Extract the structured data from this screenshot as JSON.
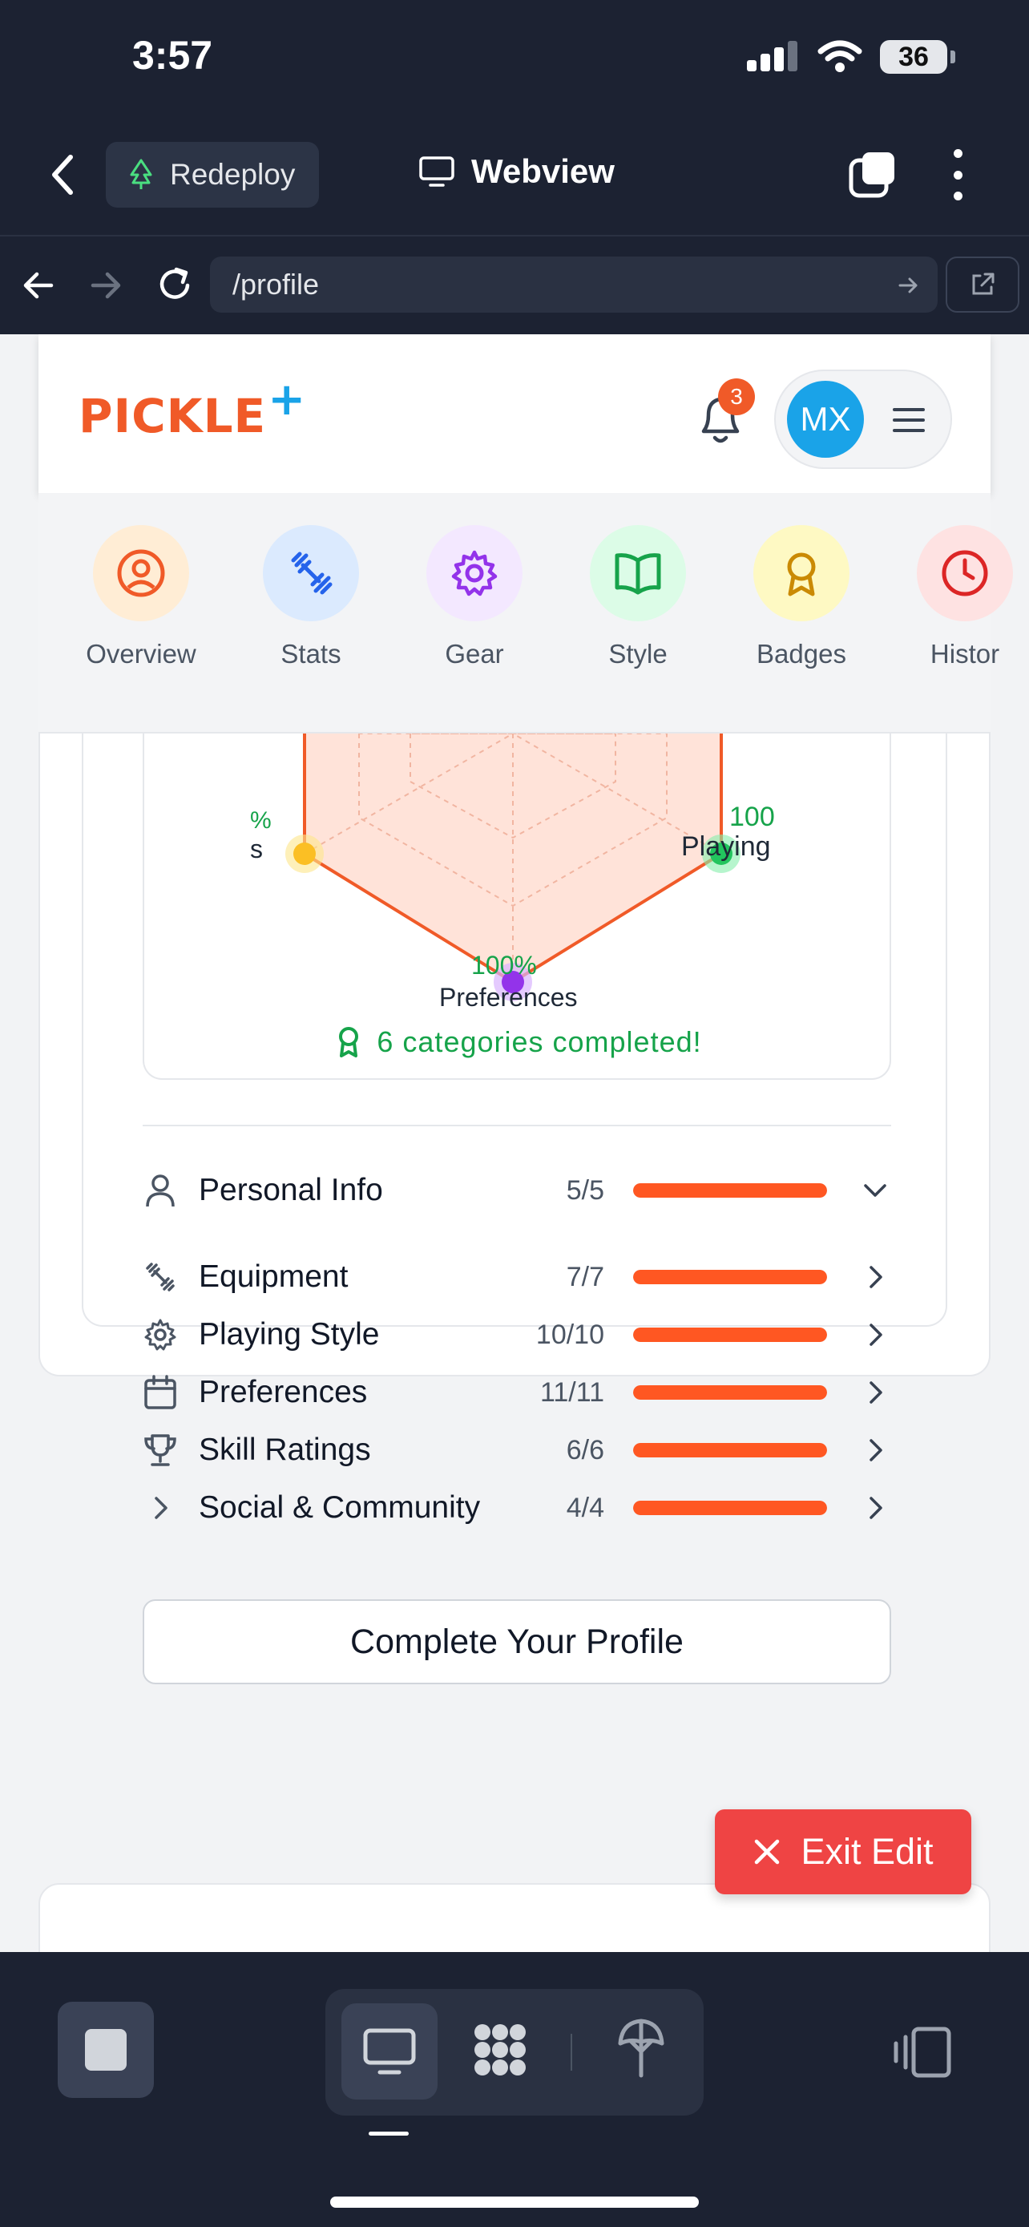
{
  "status_bar": {
    "time": "3:57",
    "battery": "36"
  },
  "app_header": {
    "redeploy_label": "Redeploy",
    "title": "Webview"
  },
  "url_bar": {
    "url": "/profile"
  },
  "site": {
    "logo_text": "PICKLE",
    "logo_plus": "+",
    "notification_count": "3",
    "avatar_initials": "MX"
  },
  "tabs": [
    {
      "label": "Overview",
      "icon": "user-circle-icon",
      "bg": "#ffedd5",
      "color": "#f05a28"
    },
    {
      "label": "Stats",
      "icon": "dumbbell-icon",
      "bg": "#dbeafe",
      "color": "#2563eb"
    },
    {
      "label": "Gear",
      "icon": "gear-icon",
      "bg": "#f3e8ff",
      "color": "#9333ea"
    },
    {
      "label": "Style",
      "icon": "book-open-icon",
      "bg": "#dcfce7",
      "color": "#16a34a"
    },
    {
      "label": "Badges",
      "icon": "award-icon",
      "bg": "#fef9c3",
      "color": "#ca8a04"
    },
    {
      "label": "Histor",
      "icon": "clock-icon",
      "bg": "#fee2e2",
      "color": "#dc2626"
    }
  ],
  "radar": {
    "left_value": "%",
    "left_label": "s",
    "right_value": "100",
    "right_label": "Playing",
    "bottom_value": "100%",
    "bottom_label": "Preferences",
    "completed_text": "6 categories completed!"
  },
  "categories": [
    {
      "name": "Personal Info",
      "count": "5/5",
      "progress": 1.0,
      "icon": "user-icon",
      "chevron": "chevron-down-icon"
    },
    {
      "name": "Equipment",
      "count": "7/7",
      "progress": 1.0,
      "icon": "dumbbell-icon",
      "chevron": "chevron-right-icon"
    },
    {
      "name": "Playing Style",
      "count": "10/10",
      "progress": 1.0,
      "icon": "gear-icon",
      "chevron": "chevron-right-icon"
    },
    {
      "name": "Preferences",
      "count": "11/11",
      "progress": 1.0,
      "icon": "calendar-icon",
      "chevron": "chevron-right-icon"
    },
    {
      "name": "Skill Ratings",
      "count": "6/6",
      "progress": 1.0,
      "icon": "trophy-icon",
      "chevron": "chevron-right-icon"
    },
    {
      "name": "Social & Community",
      "count": "4/4",
      "progress": 1.0,
      "icon": "chevron-right-icon",
      "chevron": "chevron-right-icon"
    }
  ],
  "complete_button": "Complete Your Profile",
  "exit_button": "Exit Edit",
  "colors": {
    "brand": "#f05a28",
    "accent": "#1aa3e8",
    "progress": "#ff5722",
    "success": "#16a34a",
    "danger": "#ef4444"
  }
}
